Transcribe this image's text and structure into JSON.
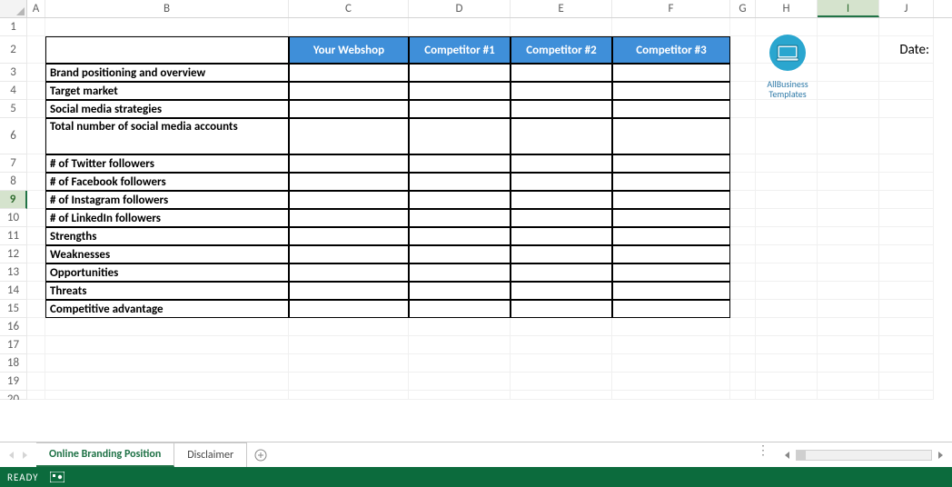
{
  "columns": [
    "A",
    "B",
    "C",
    "D",
    "E",
    "F",
    "G",
    "H",
    "I",
    "J"
  ],
  "selectedColumn": "I",
  "rowNumbers": [
    1,
    2,
    3,
    4,
    5,
    6,
    7,
    8,
    9,
    10,
    11,
    12,
    13,
    14,
    15,
    16,
    17,
    18,
    19,
    20
  ],
  "activeRow": 9,
  "header": {
    "c": "Your Webshop",
    "d": "Competitor #1",
    "e": "Competitor #2",
    "f": "Competitor #3"
  },
  "labels": {
    "r3": "Brand positioning and overview",
    "r4": "Target market",
    "r5": "Social media strategies",
    "r6": "Total number of social media accounts",
    "r7": "# of Twitter followers",
    "r8": "# of Facebook followers",
    "r9": "# of Instagram followers",
    "r10": "# of LinkedIn followers",
    "r11": "Strengths",
    "r12": "Weaknesses",
    "r13": "Opportunities",
    "r14": "Threats",
    "r15": "Competitive advantage"
  },
  "logo": {
    "line1": "AllBusiness",
    "line2": "Templates"
  },
  "dateLabel": "Date:",
  "tabs": {
    "active": "Online Branding Position",
    "second": "Disclaimer"
  },
  "status": {
    "ready": "READY"
  },
  "colors": {
    "headerBg": "#3f8fd9",
    "statusBg": "#0c6b3d",
    "tabActive": "#1e7145"
  },
  "chart_data": {
    "type": "table",
    "title": "Online Branding Position",
    "columns": [
      "",
      "Your Webshop",
      "Competitor #1",
      "Competitor #2",
      "Competitor #3"
    ],
    "rows": [
      [
        "Brand positioning and overview",
        "",
        "",
        "",
        ""
      ],
      [
        "Target market",
        "",
        "",
        "",
        ""
      ],
      [
        "Social media strategies",
        "",
        "",
        "",
        ""
      ],
      [
        "Total number of social media accounts",
        "",
        "",
        "",
        ""
      ],
      [
        "# of Twitter followers",
        "",
        "",
        "",
        ""
      ],
      [
        "# of Facebook followers",
        "",
        "",
        "",
        ""
      ],
      [
        "# of Instagram followers",
        "",
        "",
        "",
        ""
      ],
      [
        "# of LinkedIn followers",
        "",
        "",
        "",
        ""
      ],
      [
        "Strengths",
        "",
        "",
        "",
        ""
      ],
      [
        "Weaknesses",
        "",
        "",
        "",
        ""
      ],
      [
        "Opportunities",
        "",
        "",
        "",
        ""
      ],
      [
        "Threats",
        "",
        "",
        "",
        ""
      ],
      [
        "Competitive advantage",
        "",
        "",
        "",
        ""
      ]
    ]
  }
}
